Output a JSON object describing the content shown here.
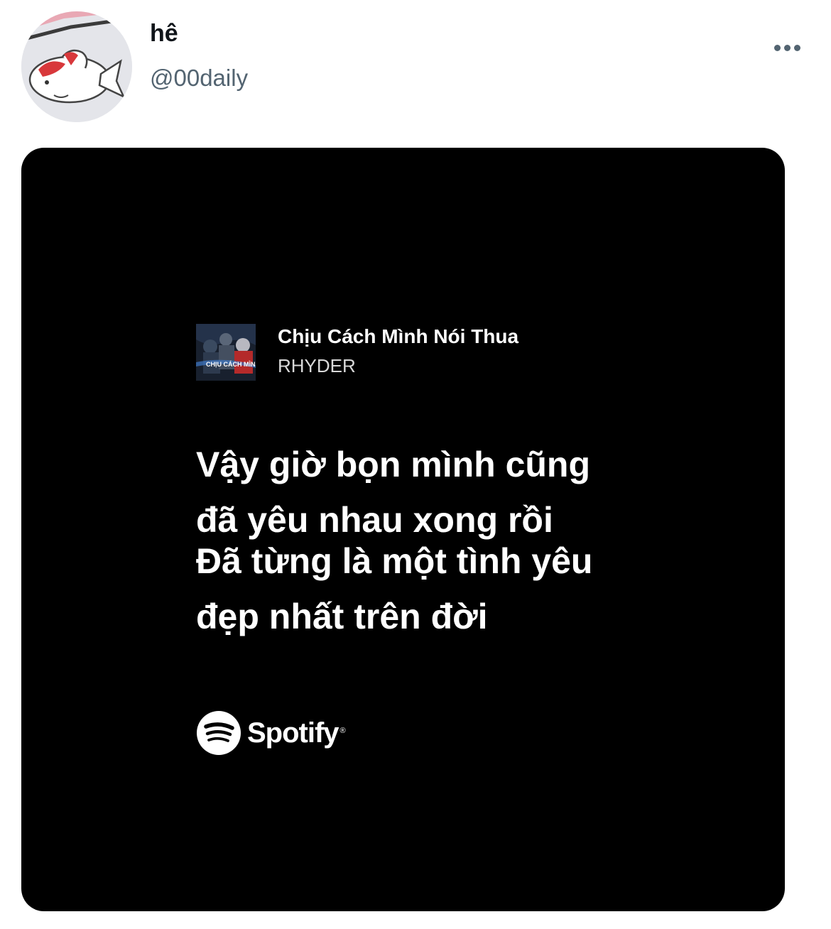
{
  "post": {
    "display_name": "hê",
    "handle": "@00daily",
    "more_icon": "more-horizontal-icon"
  },
  "share_card": {
    "album_art_text": "CHỊU CÁCH MÌNH thua",
    "song_title": "Chịu Cách Mình Nói Thua",
    "artist": "RHYDER",
    "lyrics": [
      "Vậy giờ bọn mình cũng",
      "đã yêu nhau xong rồi",
      "Đã từng là một tình yêu",
      "đẹp nhất trên đời"
    ],
    "brand": "Spotify",
    "brand_mark": "®"
  },
  "colors": {
    "card_background": "#000000",
    "handle_text": "#536471",
    "name_text": "#0f1419"
  }
}
